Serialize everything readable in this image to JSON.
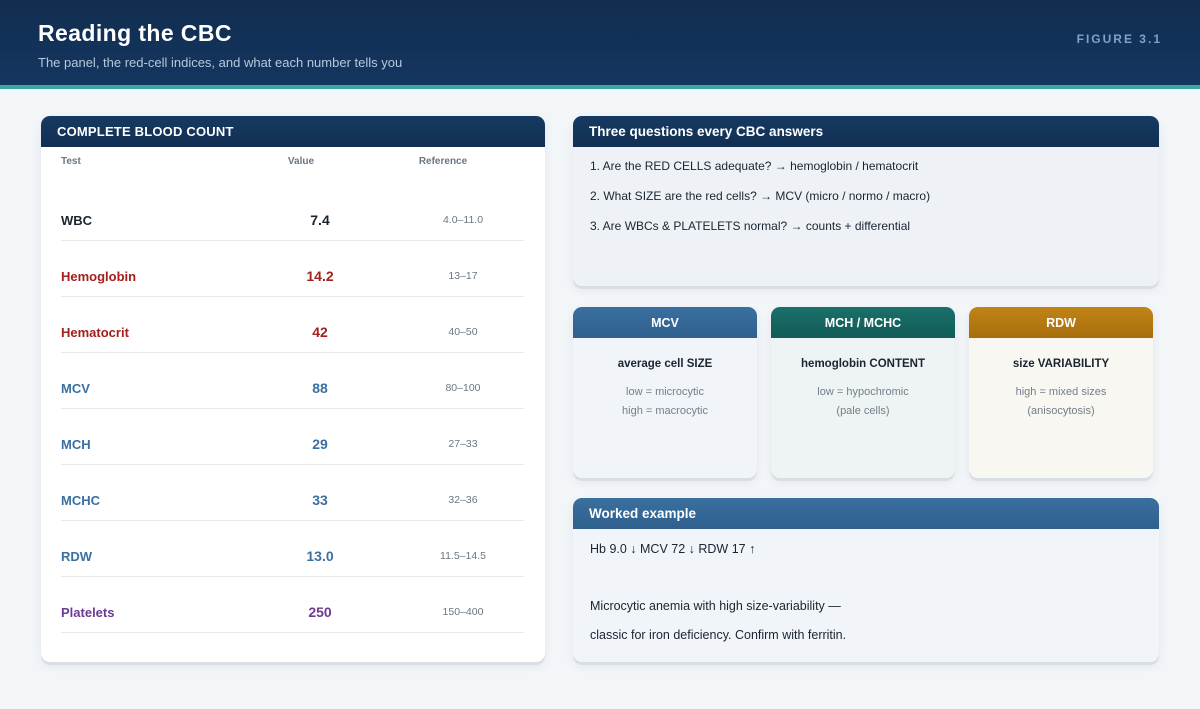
{
  "header": {
    "title": "Reading the CBC",
    "subtitle": "The panel, the red-cell indices, and what each number tells you",
    "figure": "FIGURE 3.1"
  },
  "cbc": {
    "title": "COMPLETE BLOOD COUNT",
    "columns": [
      "Test",
      "Value",
      "Reference"
    ],
    "rows": [
      {
        "test": "WBC",
        "value": "7.4",
        "reference": "4.0–11.0",
        "color": "#1b2430"
      },
      {
        "test": "Hemoglobin",
        "value": "14.2",
        "reference": "13–17",
        "color": "#a3201c"
      },
      {
        "test": "Hematocrit",
        "value": "42",
        "reference": "40–50",
        "color": "#a3201c"
      },
      {
        "test": "MCV",
        "value": "88",
        "reference": "80–100",
        "color": "#3a70a2"
      },
      {
        "test": "MCH",
        "value": "29",
        "reference": "27–33",
        "color": "#3a70a2"
      },
      {
        "test": "MCHC",
        "value": "33",
        "reference": "32–36",
        "color": "#3a70a2"
      },
      {
        "test": "RDW",
        "value": "13.0",
        "reference": "11.5–14.5",
        "color": "#3a70a2"
      },
      {
        "test": "Platelets",
        "value": "250",
        "reference": "150–400",
        "color": "#6d3a93"
      }
    ]
  },
  "questions": {
    "title": "Three questions every CBC answers",
    "items": [
      "1. Are the RED CELLS adequate? → hemoglobin / hematocrit",
      "2. What SIZE are the red cells? → MCV (micro / normo / macro)",
      "3. Are WBCs & PLATELETS normal? → counts + differential"
    ]
  },
  "indices": [
    {
      "title": "MCV",
      "main": "average cell SIZE",
      "line1": "low = microcytic",
      "line2": "high = macrocytic"
    },
    {
      "title": "MCH / MCHC",
      "main": "hemoglobin CONTENT",
      "line1": "low = hypochromic",
      "line2": "(pale cells)"
    },
    {
      "title": "RDW",
      "main": "size VARIABILITY",
      "line1": "high = mixed sizes",
      "line2": "(anisocytosis)"
    }
  ],
  "worked": {
    "title": "Worked example",
    "values": "Hb 9.0 ↓ MCV 72 ↓ RDW 17 ↑",
    "line1": "Microcytic anemia with high size-variability —",
    "line2": "classic for iron deficiency. Confirm with ferritin."
  }
}
